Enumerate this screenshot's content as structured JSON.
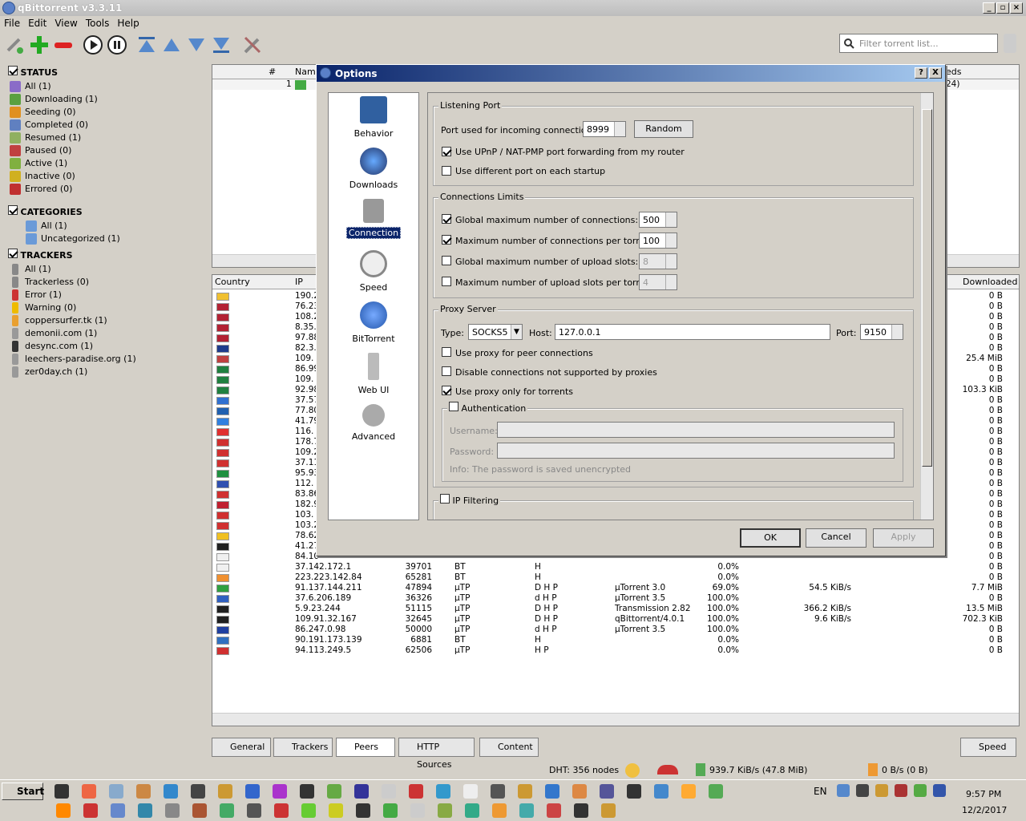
{
  "window": {
    "title": "qBittorrent v3.3.11"
  },
  "menu": [
    "File",
    "Edit",
    "View",
    "Tools",
    "Help"
  ],
  "filter": {
    "placeholder": "Filter torrent list..."
  },
  "sidebar": {
    "status_title": "STATUS",
    "status": [
      {
        "label": "All (1)",
        "color": "#8a6cc8"
      },
      {
        "label": "Downloading (1)",
        "color": "#5aa040"
      },
      {
        "label": "Seeding (0)",
        "color": "#e09020"
      },
      {
        "label": "Completed (0)",
        "color": "#6080c0"
      },
      {
        "label": "Resumed (1)",
        "color": "#90b060"
      },
      {
        "label": "Paused (0)",
        "color": "#c04040"
      },
      {
        "label": "Active (1)",
        "color": "#80b040"
      },
      {
        "label": "Inactive (0)",
        "color": "#d0b020"
      },
      {
        "label": "Errored (0)",
        "color": "#c03030"
      }
    ],
    "categories_title": "CATEGORIES",
    "categories": [
      "All  (1)",
      "Uncategorized  (1)"
    ],
    "trackers_title": "TRACKERS",
    "trackers": [
      "All (1)",
      "Trackerless (0)",
      "Error (1)",
      "Warning (0)",
      "coppersurfer.tk (1)",
      "demonii.com (1)",
      "desync.com (1)",
      "leechers-paradise.org (1)",
      "zer0day.ch (1)"
    ]
  },
  "torrent_table": {
    "headers": [
      "#",
      "Name",
      "eds"
    ],
    "row": {
      "num": "1",
      "ratio": "24)"
    }
  },
  "peers": {
    "headers": {
      "country": "Country",
      "ip": "IP",
      "downloaded": "Downloaded"
    },
    "rows": [
      {
        "ip": "190.2",
        "down": "0 B",
        "flag": "#f0c030"
      },
      {
        "ip": "76.23",
        "down": "0 B",
        "flag": "#b22234"
      },
      {
        "ip": "108.2",
        "down": "0 B",
        "flag": "#b22234"
      },
      {
        "ip": "8.35.",
        "down": "0 B",
        "flag": "#b22234"
      },
      {
        "ip": "97.88",
        "down": "0 B",
        "flag": "#b22234"
      },
      {
        "ip": "82.3.",
        "down": "0 B",
        "flag": "#1e3c8c"
      },
      {
        "ip": "109.",
        "down": "25.4 MiB",
        "flag": "#c04040"
      },
      {
        "ip": "86.99",
        "down": "0 B",
        "flag": "#208040"
      },
      {
        "ip": "109.",
        "down": "0 B",
        "flag": "#208040"
      },
      {
        "ip": "92.98",
        "down": "103.3 KiB",
        "flag": "#208040"
      },
      {
        "ip": "37.57",
        "down": "0 B",
        "flag": "#3070d0"
      },
      {
        "ip": "77.80",
        "down": "0 B",
        "flag": "#2060b0"
      },
      {
        "ip": "41.79",
        "down": "0 B",
        "flag": "#3080e0"
      },
      {
        "ip": "116.",
        "down": "0 B",
        "flag": "#e03030"
      },
      {
        "ip": "178.7",
        "down": "0 B",
        "flag": "#d03030"
      },
      {
        "ip": "109.2",
        "down": "0 B",
        "flag": "#d03030"
      },
      {
        "ip": "37.11",
        "down": "0 B",
        "flag": "#d03030"
      },
      {
        "ip": "95.93",
        "down": "0 B",
        "flag": "#209040"
      },
      {
        "ip": "112.",
        "down": "0 B",
        "flag": "#3050b0"
      },
      {
        "ip": "83.86",
        "down": "0 B",
        "flag": "#d03030"
      },
      {
        "ip": "182.9",
        "down": "0 B",
        "flag": "#c02030"
      },
      {
        "ip": "103.",
        "down": "0 B",
        "flag": "#d03030"
      },
      {
        "ip": "103.2",
        "down": "0 B",
        "flag": "#d03030"
      },
      {
        "ip": "78.62",
        "down": "0 B",
        "flag": "#f0c020"
      },
      {
        "ip": "41.27",
        "down": "0 B",
        "flag": "#202020"
      },
      {
        "ip": "84.10",
        "down": "0 B",
        "flag": "#f0f0f0"
      },
      {
        "ip": "37.142.172.1",
        "port": "39701",
        "conn": "BT",
        "flags": "H",
        "client": "",
        "progress": "0.0%",
        "speed": "",
        "down": "0 B",
        "flag": "#f0f0f0"
      },
      {
        "ip": "223.223.142.84",
        "port": "65281",
        "conn": "BT",
        "flags": "H",
        "client": "",
        "progress": "0.0%",
        "speed": "",
        "down": "0 B",
        "flag": "#f09030"
      },
      {
        "ip": "91.137.144.211",
        "port": "47894",
        "conn": "µTP",
        "flags": "D H P",
        "client": "µTorrent 3.0",
        "progress": "69.0%",
        "speed": "54.5 KiB/s",
        "down": "7.7 MiB",
        "flag": "#30a040"
      },
      {
        "ip": "37.6.206.189",
        "port": "36326",
        "conn": "µTP",
        "flags": "d H P",
        "client": "µTorrent 3.5",
        "progress": "100.0%",
        "speed": "",
        "down": "0 B",
        "flag": "#3060c0"
      },
      {
        "ip": "5.9.23.244",
        "port": "51115",
        "conn": "µTP",
        "flags": "D H P",
        "client": "Transmission 2.82",
        "progress": "100.0%",
        "speed": "366.2 KiB/s",
        "down": "13.5 MiB",
        "flag": "#202020"
      },
      {
        "ip": "109.91.32.167",
        "port": "32645",
        "conn": "µTP",
        "flags": "D H P",
        "client": "qBittorrent/4.0.1",
        "progress": "100.0%",
        "speed": "9.6 KiB/s",
        "down": "702.3 KiB",
        "flag": "#202020"
      },
      {
        "ip": "86.247.0.98",
        "port": "50000",
        "conn": "µTP",
        "flags": "d H P",
        "client": "µTorrent 3.5",
        "progress": "100.0%",
        "speed": "",
        "down": "0 B",
        "flag": "#2040a0"
      },
      {
        "ip": "90.191.173.139",
        "port": "6881",
        "conn": "BT",
        "flags": "H",
        "client": "",
        "progress": "0.0%",
        "speed": "",
        "down": "0 B",
        "flag": "#3070c0"
      },
      {
        "ip": "94.113.249.5",
        "port": "62506",
        "conn": "µTP",
        "flags": "H P",
        "client": "",
        "progress": "0.0%",
        "speed": "",
        "down": "0 B",
        "flag": "#d03030"
      }
    ]
  },
  "tabs": [
    "General",
    "Trackers",
    "Peers",
    "HTTP Sources",
    "Content"
  ],
  "speed_btn": "Speed",
  "statusbar": {
    "dht": "DHT: 356 nodes",
    "down": "939.7 KiB/s (47.8 MiB)",
    "up": "0 B/s (0 B)"
  },
  "taskbar": {
    "start": "Start",
    "lang": "EN",
    "time": "9:57 PM",
    "date": "12/2/2017"
  },
  "dialog": {
    "title": "Options",
    "help": "?",
    "close": "X",
    "nav": [
      "Behavior",
      "Downloads",
      "Connection",
      "Speed",
      "BitTorrent",
      "Web UI",
      "Advanced"
    ],
    "listening": {
      "title": "Listening Port",
      "port_label": "Port used for incoming connections:",
      "port": "8999",
      "random": "Random",
      "upnp": "Use UPnP / NAT-PMP port forwarding from my router",
      "diffport": "Use different port on each startup"
    },
    "limits": {
      "title": "Connections Limits",
      "global_conn": "Global maximum number of connections:",
      "global_conn_val": "500",
      "per_torrent": "Maximum number of connections per torrent:",
      "per_torrent_val": "100",
      "global_upload": "Global maximum number of upload slots:",
      "global_upload_val": "8",
      "upload_per": "Maximum number of upload slots per torrent:",
      "upload_per_val": "4"
    },
    "proxy": {
      "title": "Proxy Server",
      "type_label": "Type:",
      "type": "SOCKS5",
      "host_label": "Host:",
      "host": "127.0.0.1",
      "port_label": "Port:",
      "port": "9150",
      "peer": "Use proxy for peer connections",
      "disable": "Disable connections not supported by proxies",
      "only": "Use proxy only for torrents",
      "auth": "Authentication",
      "user": "Username:",
      "pass": "Password:",
      "info": "Info: The password is saved unencrypted"
    },
    "ipfilter": "IP Filtering",
    "ok": "OK",
    "cancel": "Cancel",
    "apply": "Apply"
  }
}
